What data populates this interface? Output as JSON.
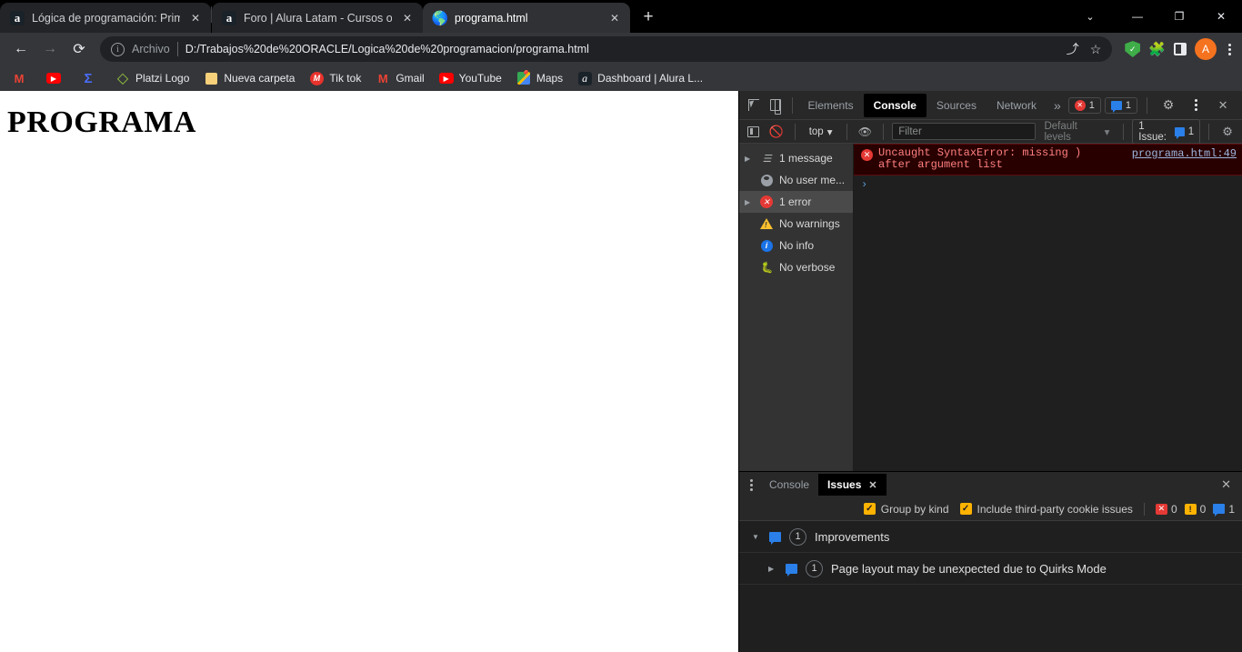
{
  "browser": {
    "tabs": [
      {
        "title": "Lógica de programación: Primero",
        "favicon": "alura-icon",
        "active": false
      },
      {
        "title": "Foro | Alura Latam - Cursos onlin",
        "favicon": "alura-icon",
        "active": false
      },
      {
        "title": "programa.html",
        "favicon": "globe-icon",
        "active": true
      }
    ],
    "new_tab_label": "+",
    "window_controls": {
      "chevron": "⌄",
      "minimize": "—",
      "restore": "❐",
      "close": "✕"
    },
    "toolbar": {
      "back": "←",
      "forward": "→",
      "reload": "⟳",
      "omnibox_scheme": "Archivo",
      "omnibox_url": "D:/Trabajos%20de%20ORACLE/Logica%20de%20programacion/programa.html",
      "share_icon": "⤴",
      "bookmark_star": "☆",
      "avatar_letter": "A"
    },
    "bookmarks": [
      {
        "label": "",
        "icon": "gmail-icon"
      },
      {
        "label": "",
        "icon": "youtube-icon"
      },
      {
        "label": "",
        "icon": "sigma-icon"
      },
      {
        "label": "Platzi Logo",
        "icon": "platzi-icon"
      },
      {
        "label": "Nueva carpeta",
        "icon": "folder-icon"
      },
      {
        "label": "Tik tok",
        "icon": "tiktok-icon"
      },
      {
        "label": "Gmail",
        "icon": "gmail-icon"
      },
      {
        "label": "YouTube",
        "icon": "youtube-icon"
      },
      {
        "label": "Maps",
        "icon": "maps-icon"
      },
      {
        "label": "Dashboard | Alura L...",
        "icon": "alura-icon"
      }
    ]
  },
  "page": {
    "heading": "PROGRAMA"
  },
  "devtools": {
    "tabs": [
      {
        "label": "Elements",
        "selected": false
      },
      {
        "label": "Console",
        "selected": true
      },
      {
        "label": "Sources",
        "selected": false
      },
      {
        "label": "Network",
        "selected": false
      }
    ],
    "more_tabs": "»",
    "error_badge": "1",
    "message_badge": "1",
    "settings_icon": "⚙",
    "close_icon": "✕",
    "console_toolbar": {
      "context": "top",
      "filter_placeholder": "Filter",
      "filter_value": "",
      "levels": "Default levels",
      "issue_pill_label": "1 Issue:",
      "issue_pill_count": "1"
    },
    "sidebar": [
      {
        "label": "1 message",
        "icon": "list-icon",
        "expandable": true,
        "selected": false
      },
      {
        "label": "No user me...",
        "icon": "user-message-icon",
        "expandable": false,
        "selected": false
      },
      {
        "label": "1 error",
        "icon": "error-icon",
        "expandable": true,
        "selected": true
      },
      {
        "label": "No warnings",
        "icon": "warning-icon",
        "expandable": false,
        "selected": false
      },
      {
        "label": "No info",
        "icon": "info-icon",
        "expandable": false,
        "selected": false
      },
      {
        "label": "No verbose",
        "icon": "bug-icon",
        "expandable": false,
        "selected": false
      }
    ],
    "console_message": {
      "text": "Uncaught SyntaxError: missing ) after argument list",
      "source": "programa.html:49"
    },
    "prompt_caret": "›",
    "drawer": {
      "tabs": [
        {
          "label": "Console",
          "selected": false,
          "closable": false
        },
        {
          "label": "Issues",
          "selected": true,
          "closable": true
        }
      ],
      "close_icon": "✕",
      "group_by_kind_label": "Group by kind",
      "group_by_kind_checked": true,
      "third_party_label": "Include third-party cookie issues",
      "third_party_checked": true,
      "counts": {
        "errors": "0",
        "warnings": "0",
        "improvements": "1"
      },
      "rows": [
        {
          "label": "Improvements",
          "count": "1",
          "expanded": true,
          "child": false
        },
        {
          "label": "Page layout may be unexpected due to Quirks Mode",
          "count": "1",
          "expanded": false,
          "child": true
        }
      ]
    }
  },
  "colors": {
    "accent_error": "#e53935",
    "accent_info": "#2a7fe8",
    "accent_warning": "#ffb300",
    "avatar": "#f5721f"
  }
}
